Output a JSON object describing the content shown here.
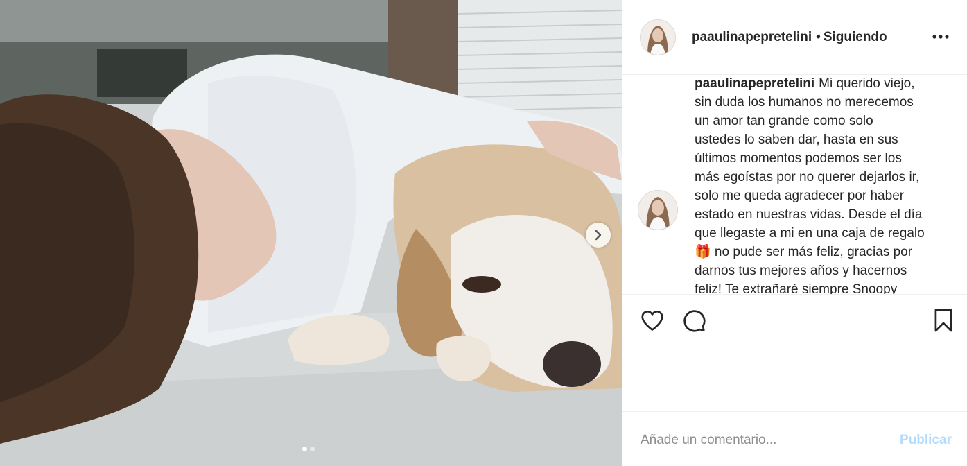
{
  "post": {
    "username": "paaulinapepretelini",
    "separator": "•",
    "follow_status": "Siguiendo",
    "caption_username": "paaulinapepretelini",
    "caption_text": "Mi querido viejo,\nsin duda los humanos no merecemos\nun amor tan grande como solo\nustedes lo saben dar, hasta en sus\núltimos momentos podemos ser los\nmás egoístas por no querer dejarlos ir,\nsolo me queda agradecer por haber\nestado en nuestras vidas. Desde el día\nque llegaste a mi en una caja de regalo\n🎁 no pude ser más feliz, gracias por\ndarnos tus mejores años y hacernos\nfeliz! Te extrañaré siempre Snoopy"
  },
  "carousel": {
    "current_slide": 1,
    "total_slides": 2
  },
  "icons": {
    "more": "more-options-icon",
    "like": "heart-icon",
    "comment": "comment-icon",
    "save": "bookmark-icon",
    "next": "chevron-right-icon"
  },
  "comment_box": {
    "placeholder": "Añade un comentario...",
    "publish_label": "Publicar"
  },
  "colors": {
    "publish_disabled": "#b3dbff",
    "text_primary": "#262626",
    "text_secondary": "#8e8e8e",
    "border": "#efefef"
  }
}
